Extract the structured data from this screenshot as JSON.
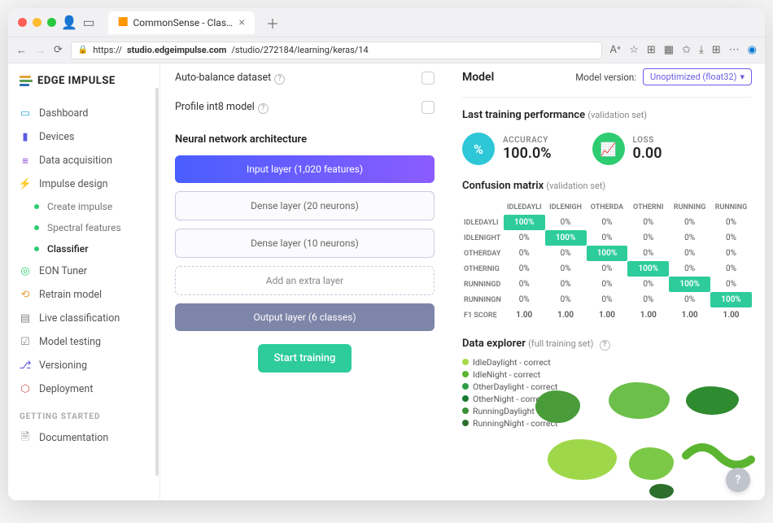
{
  "browser": {
    "tab_title": "CommonSense - Classifier - E",
    "url_prefix": "https://",
    "url_host": "studio.edgeimpulse.com",
    "url_path": "/studio/272184/learning/keras/14"
  },
  "brand": "EDGE IMPULSE",
  "nav": {
    "dashboard": "Dashboard",
    "devices": "Devices",
    "data_acq": "Data acquisition",
    "impulse": "Impulse design",
    "create_impulse": "Create impulse",
    "spectral": "Spectral features",
    "classifier": "Classifier",
    "eon": "EON Tuner",
    "retrain": "Retrain model",
    "live": "Live classification",
    "testing": "Model testing",
    "versioning": "Versioning",
    "deployment": "Deployment",
    "getting_started": "GETTING STARTED",
    "documentation": "Documentation"
  },
  "form": {
    "auto_balance": "Auto-balance dataset",
    "profile_int8": "Profile int8 model",
    "nn_arch": "Neural network architecture",
    "input_layer": "Input layer (1,020 features)",
    "dense20": "Dense layer (20 neurons)",
    "dense10": "Dense layer (10 neurons)",
    "add_layer": "Add an extra layer",
    "output_layer": "Output layer (6 classes)",
    "start_training": "Start training"
  },
  "model": {
    "title": "Model",
    "version_label": "Model version:",
    "version_value": "Unoptimized (float32)",
    "last_perf": "Last training performance",
    "validation_set": "(validation set)",
    "accuracy_label": "ACCURACY",
    "accuracy_value": "100.0%",
    "loss_label": "LOSS",
    "loss_value": "0.00",
    "confusion_title": "Confusion matrix",
    "explorer_title": "Data explorer",
    "full_training": "(full training set)"
  },
  "chart_data": {
    "type": "table",
    "title": "Confusion matrix (validation set)",
    "columns": [
      "IDLEDAYLI",
      "IDLENIGH",
      "OTHERDA",
      "OTHERNI",
      "RUNNING",
      "RUNNING"
    ],
    "rows": [
      {
        "label": "IDLEDAYLI",
        "values": [
          "100%",
          "0%",
          "0%",
          "0%",
          "0%",
          "0%"
        ],
        "hit": 0
      },
      {
        "label": "IDLENIGHT",
        "values": [
          "0%",
          "100%",
          "0%",
          "0%",
          "0%",
          "0%"
        ],
        "hit": 1
      },
      {
        "label": "OTHERDAY",
        "values": [
          "0%",
          "0%",
          "100%",
          "0%",
          "0%",
          "0%"
        ],
        "hit": 2
      },
      {
        "label": "OTHERNIG",
        "values": [
          "0%",
          "0%",
          "0%",
          "100%",
          "0%",
          "0%"
        ],
        "hit": 3
      },
      {
        "label": "RUNNINGD",
        "values": [
          "0%",
          "0%",
          "0%",
          "0%",
          "100%",
          "0%"
        ],
        "hit": 4
      },
      {
        "label": "RUNNINGN",
        "values": [
          "0%",
          "0%",
          "0%",
          "0%",
          "0%",
          "100%"
        ],
        "hit": 5
      }
    ],
    "f1_label": "F1 SCORE",
    "f1_values": [
      "1.00",
      "1.00",
      "1.00",
      "1.00",
      "1.00",
      "1.00"
    ]
  },
  "legend": [
    {
      "label": "IdleDaylight - correct",
      "color": "#a9d84a"
    },
    {
      "label": "IdleNight - correct",
      "color": "#5bb531"
    },
    {
      "label": "OtherDaylight - correct",
      "color": "#2f9e44"
    },
    {
      "label": "OtherNight - correct",
      "color": "#1b7a2e"
    },
    {
      "label": "RunningDaylight - correct",
      "color": "#3a8f3a"
    },
    {
      "label": "RunningNight - correct",
      "color": "#2d6e2d"
    }
  ]
}
